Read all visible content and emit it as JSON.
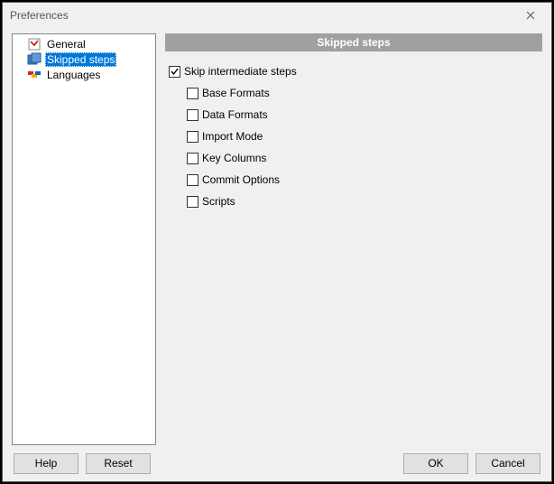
{
  "window": {
    "title": "Preferences"
  },
  "tree": {
    "items": [
      {
        "label": "General"
      },
      {
        "label": "Skipped steps"
      },
      {
        "label": "Languages"
      }
    ],
    "selected_index": 1
  },
  "panel": {
    "header": "Skipped steps",
    "master_label": "Skip intermediate steps",
    "master_checked": true,
    "options": [
      {
        "label": "Base Formats",
        "checked": false
      },
      {
        "label": "Data Formats",
        "checked": false
      },
      {
        "label": "Import Mode",
        "checked": false
      },
      {
        "label": "Key Columns",
        "checked": false
      },
      {
        "label": "Commit Options",
        "checked": false
      },
      {
        "label": "Scripts",
        "checked": false
      }
    ]
  },
  "buttons": {
    "help": "Help",
    "reset": "Reset",
    "ok": "OK",
    "cancel": "Cancel"
  }
}
